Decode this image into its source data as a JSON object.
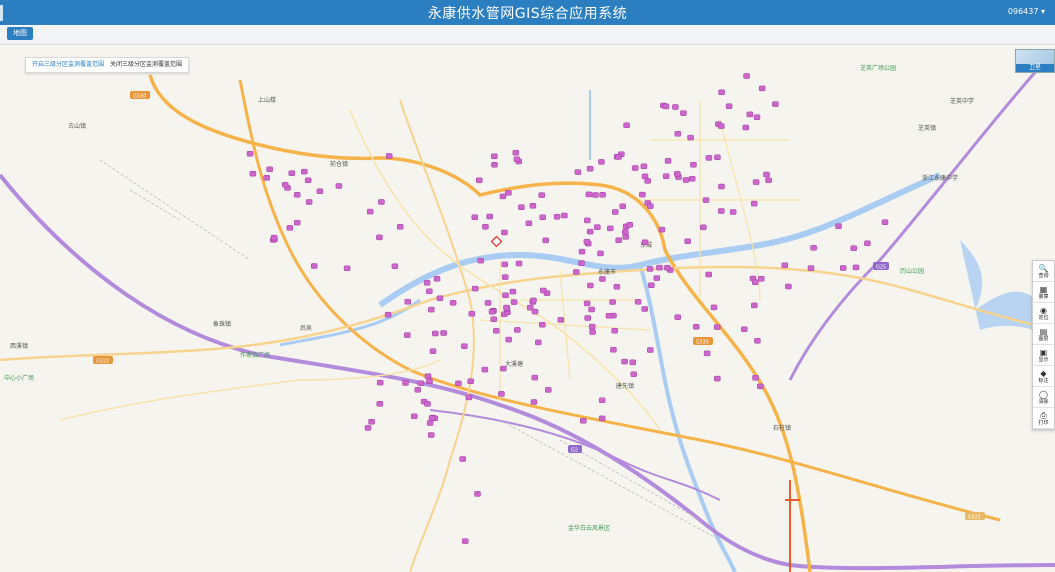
{
  "header": {
    "title": "永康供水管网GIS综合应用系统",
    "user": "096437 ▾"
  },
  "toolbar": {
    "map_tab": "地图"
  },
  "zone_panel": {
    "open": "开启三级分区监测覆盖范围",
    "close": "关闭三级分区监测覆盖范围"
  },
  "thumbnail": {
    "label": "卫星"
  },
  "side_tools": [
    {
      "label": "查询",
      "icon": "search-icon",
      "glyph": "🔍"
    },
    {
      "label": "量算",
      "icon": "measure-icon",
      "glyph": "▦"
    },
    {
      "label": "定位",
      "icon": "location-icon",
      "glyph": "◉"
    },
    {
      "label": "图层",
      "icon": "layers-icon",
      "glyph": "▤"
    },
    {
      "label": "显示",
      "icon": "display-icon",
      "glyph": "▣"
    },
    {
      "label": "标注",
      "icon": "tag-icon",
      "glyph": "◆"
    },
    {
      "label": "清除",
      "icon": "clear-icon",
      "glyph": "◯"
    },
    {
      "label": "打印",
      "icon": "print-icon",
      "glyph": "⎙"
    }
  ],
  "map_labels": {
    "place_names": [
      "西溪镇",
      "芝英镇",
      "象珠镇",
      "前仓镇",
      "古山镇",
      "石柱镇",
      "唐先镇",
      "芝英中学",
      "东城",
      "永康市",
      "后吴",
      "上山楼",
      "大溪塘",
      "浙江永康中学"
    ],
    "pois": [
      "中心小广场",
      "金华白云风景区",
      "芝英广场公园",
      "历山公园",
      "作家会广场"
    ],
    "road_tags": [
      "G330",
      "G322",
      "S322",
      "G2",
      "G25",
      "S330"
    ]
  },
  "colors": {
    "header_bg": "#2b7ec0",
    "marker": "#cc66cc",
    "highway": "#b38bdc",
    "national_road": "#f5b34a"
  }
}
